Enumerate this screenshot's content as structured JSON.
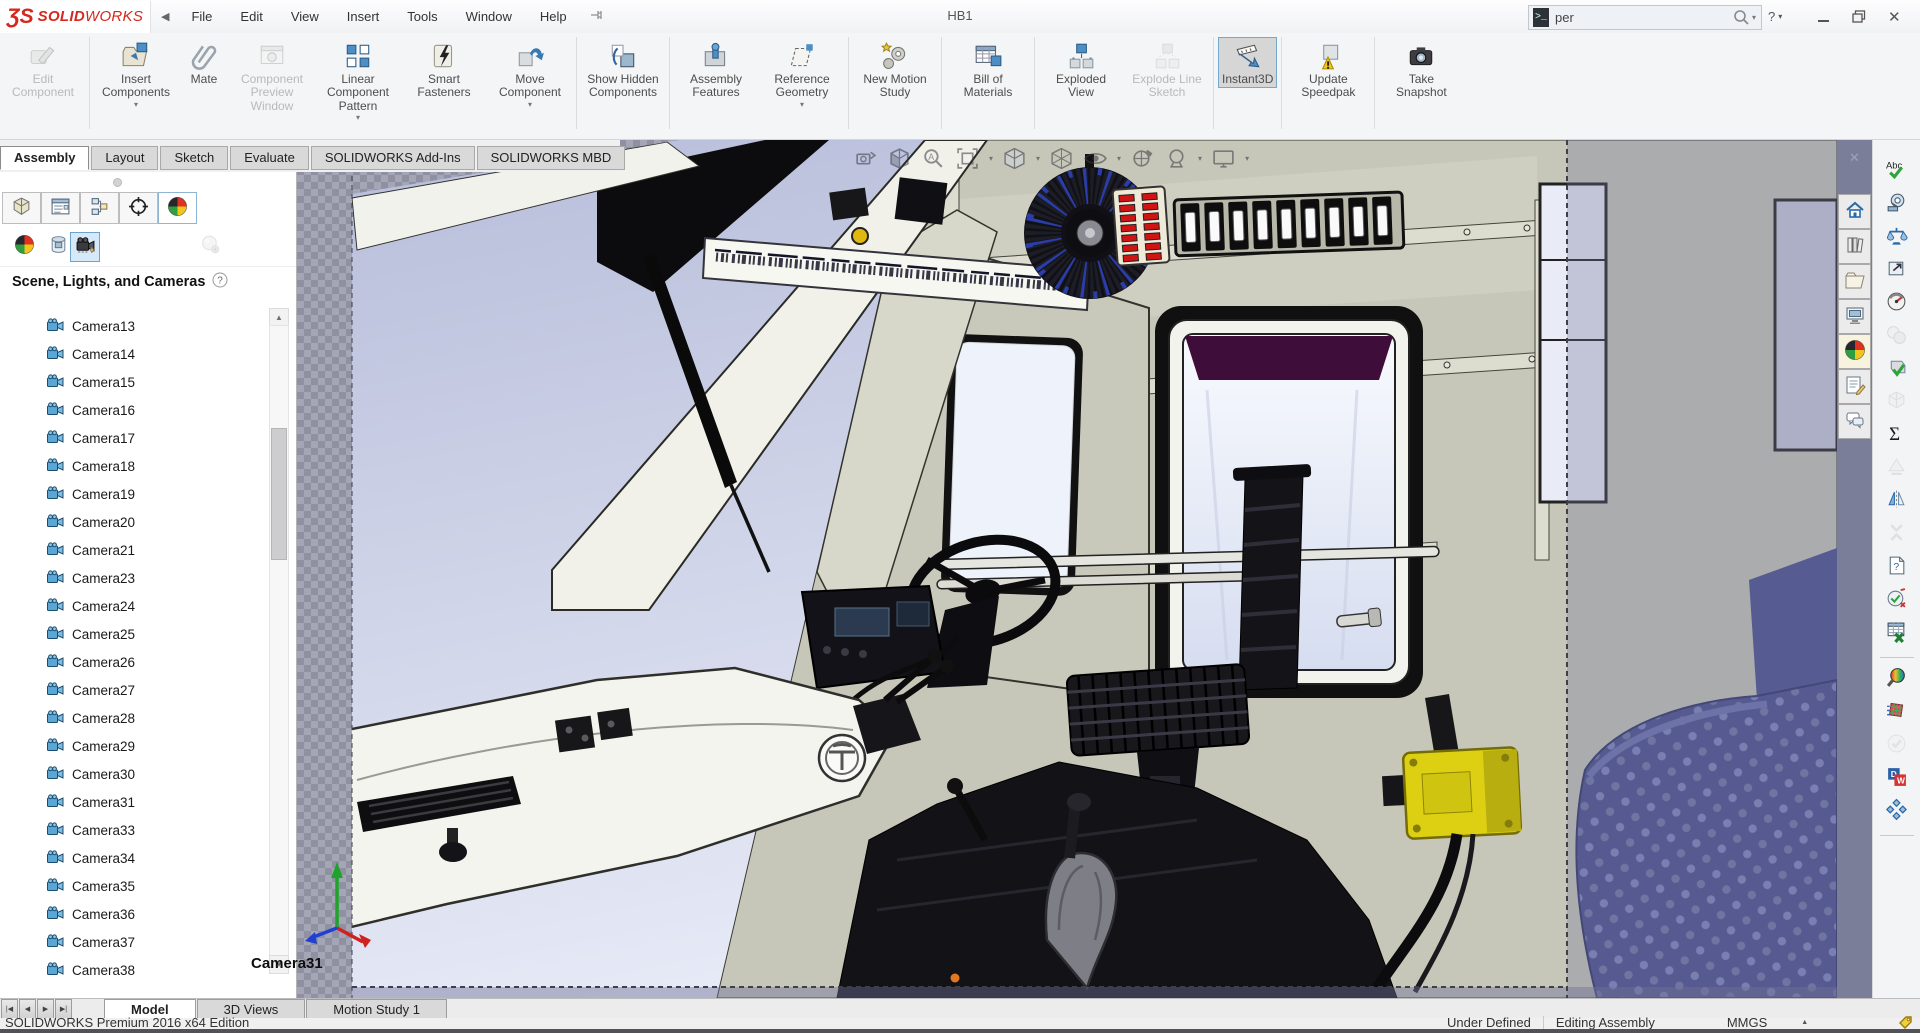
{
  "titlebar": {
    "logo_ds": "ƷS",
    "logo_solid": "SOLID",
    "logo_works": "WORKS",
    "collapse_icon": "◀",
    "menus": [
      "File",
      "Edit",
      "View",
      "Insert",
      "Tools",
      "Window",
      "Help"
    ],
    "document_title": "HB1",
    "search_value": "per",
    "help_label": "?"
  },
  "ribbon": {
    "buttons": [
      {
        "label": "Edit Component",
        "icon": "edit-component",
        "disabled": true,
        "group_end": true
      },
      {
        "label": "Insert Components",
        "icon": "insert-components",
        "dropdown": true
      },
      {
        "label": "Mate",
        "icon": "mate"
      },
      {
        "label": "Component Preview Window",
        "icon": "component-preview",
        "disabled": true
      },
      {
        "label": "Linear Component Pattern",
        "icon": "linear-pattern",
        "dropdown": true
      },
      {
        "label": "Smart Fasteners",
        "icon": "smart-fasteners"
      },
      {
        "label": "Move Component",
        "icon": "move-component",
        "dropdown": true,
        "group_end": true
      },
      {
        "label": "Show Hidden Components",
        "icon": "show-hidden",
        "group_end": true
      },
      {
        "label": "Assembly Features",
        "icon": "assembly-features"
      },
      {
        "label": "Reference Geometry",
        "icon": "reference-geometry",
        "dropdown": true,
        "group_end": true
      },
      {
        "label": "New Motion Study",
        "icon": "motion-study",
        "group_end": true
      },
      {
        "label": "Bill of Materials",
        "icon": "bom",
        "group_end": true
      },
      {
        "label": "Exploded View",
        "icon": "exploded-view"
      },
      {
        "label": "Explode Line Sketch",
        "icon": "explode-line",
        "disabled": true,
        "group_end": true
      },
      {
        "label": "Instant3D",
        "icon": "instant3d",
        "active": true,
        "group_end": true
      },
      {
        "label": "Update Speedpak",
        "icon": "update-speedpak",
        "group_end": true
      },
      {
        "label": "Take Snapshot",
        "icon": "take-snapshot"
      }
    ]
  },
  "feature_tabs": {
    "active": "Assembly",
    "items": [
      "Assembly",
      "Layout",
      "Sketch",
      "Evaluate",
      "SOLIDWORKS Add-Ins",
      "SOLIDWORKS MBD"
    ]
  },
  "left_panel": {
    "manager_tabs": [
      "feature-manager",
      "property-manager",
      "configuration-manager",
      "dimxpert-manager",
      "display-manager"
    ],
    "active_manager_tab": "display-manager",
    "display_tools": [
      "appearances",
      "decals",
      "scene-lights-cameras",
      "contours"
    ],
    "active_display_tool": "scene-lights-cameras",
    "header": "Scene, Lights, and Cameras",
    "cameras": [
      "Camera13",
      "Camera14",
      "Camera15",
      "Camera16",
      "Camera17",
      "Camera18",
      "Camera19",
      "Camera20",
      "Camera21",
      "Camera23",
      "Camera24",
      "Camera25",
      "Camera26",
      "Camera27",
      "Camera28",
      "Camera29",
      "Camera30",
      "Camera31",
      "Camera33",
      "Camera34",
      "Camera35",
      "Camera36",
      "Camera37",
      "Camera38"
    ]
  },
  "viewport": {
    "camera_label": "Camera31",
    "hud_icons": [
      "zoom-prev",
      "section-view",
      "zoom-area",
      "zoom-fit",
      "view-orientation",
      "display-style",
      "hide-show-items",
      "edit-appearance",
      "apply-scene",
      "view-settings"
    ]
  },
  "task_pane": {
    "tabs": [
      "home",
      "design-library",
      "file-explorer",
      "view-palette",
      "appearances",
      "custom-properties",
      "forum"
    ],
    "tools": [
      "spell-checker",
      "measure",
      "mass-properties",
      "section-properties",
      "performance-evaluation",
      "curvature",
      "check-entity",
      "thickness-analysis",
      "equations",
      "import-diagnostics",
      "mirror-components",
      "compress",
      "design-binder",
      "compare-documents",
      "export-excel",
      "separator",
      "rendering",
      "simulation",
      "inspection",
      "driveworks",
      "edrawings",
      "separator"
    ],
    "disabled_tools": [
      "curvature",
      "thickness-analysis",
      "import-diagnostics",
      "compress",
      "inspection"
    ]
  },
  "doc_tabs": {
    "active": "Model",
    "items": [
      "Model",
      "3D Views",
      "Motion Study 1"
    ]
  },
  "status_bar": {
    "left": "SOLIDWORKS Premium 2016 x64 Edition",
    "right": [
      "Under Defined",
      "Editing Assembly",
      "MMGS"
    ]
  }
}
